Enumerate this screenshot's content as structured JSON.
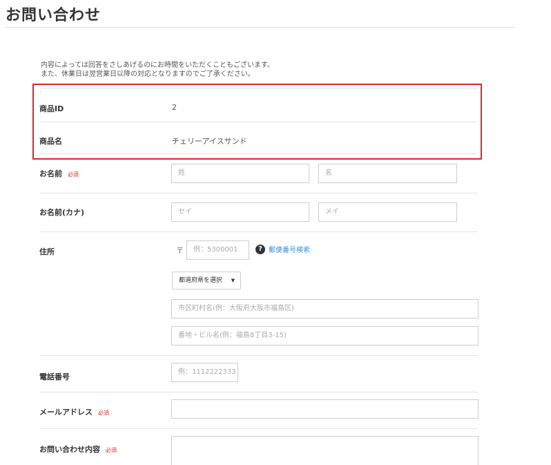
{
  "page": {
    "title": "お問い合わせ"
  },
  "intro": {
    "line1": "内容によっては回答をさしあげるのにお時間をいただくこともございます。",
    "line2": "また、休業日は翌営業日以降の対応となりますのでご了承ください。"
  },
  "product": {
    "id_label": "商品ID",
    "id_value": "2",
    "name_label": "商品名",
    "name_value": "チェリーアイスサンド"
  },
  "form": {
    "required_badge": "必須",
    "name": {
      "label": "お名前",
      "last_placeholder": "姓",
      "first_placeholder": "名"
    },
    "kana": {
      "label": "お名前(カナ)",
      "last_placeholder": "セイ",
      "first_placeholder": "メイ"
    },
    "address": {
      "label": "住所",
      "postal_mark": "〒",
      "postal_placeholder": "例：5300001",
      "help_icon": "?",
      "zip_search_link": "郵便番号検索",
      "prefecture_select": "都道府県を選択",
      "city_placeholder": "市区町村名(例：大阪府大阪市福島区)",
      "street_placeholder": "番地・ビル名(例：福島8丁目3-15)"
    },
    "phone": {
      "label": "電話番号",
      "placeholder": "例：1112222333"
    },
    "email": {
      "label": "メールアドレス",
      "placeholder": ""
    },
    "inquiry": {
      "label": "お問い合わせ内容",
      "placeholder": ""
    }
  },
  "icons": {
    "help": "question-circle-icon",
    "select_arrow": "caret-down-icon"
  },
  "colors": {
    "highlight": "#d7262e",
    "required": "#d0332b",
    "link": "#3a8fd1"
  }
}
